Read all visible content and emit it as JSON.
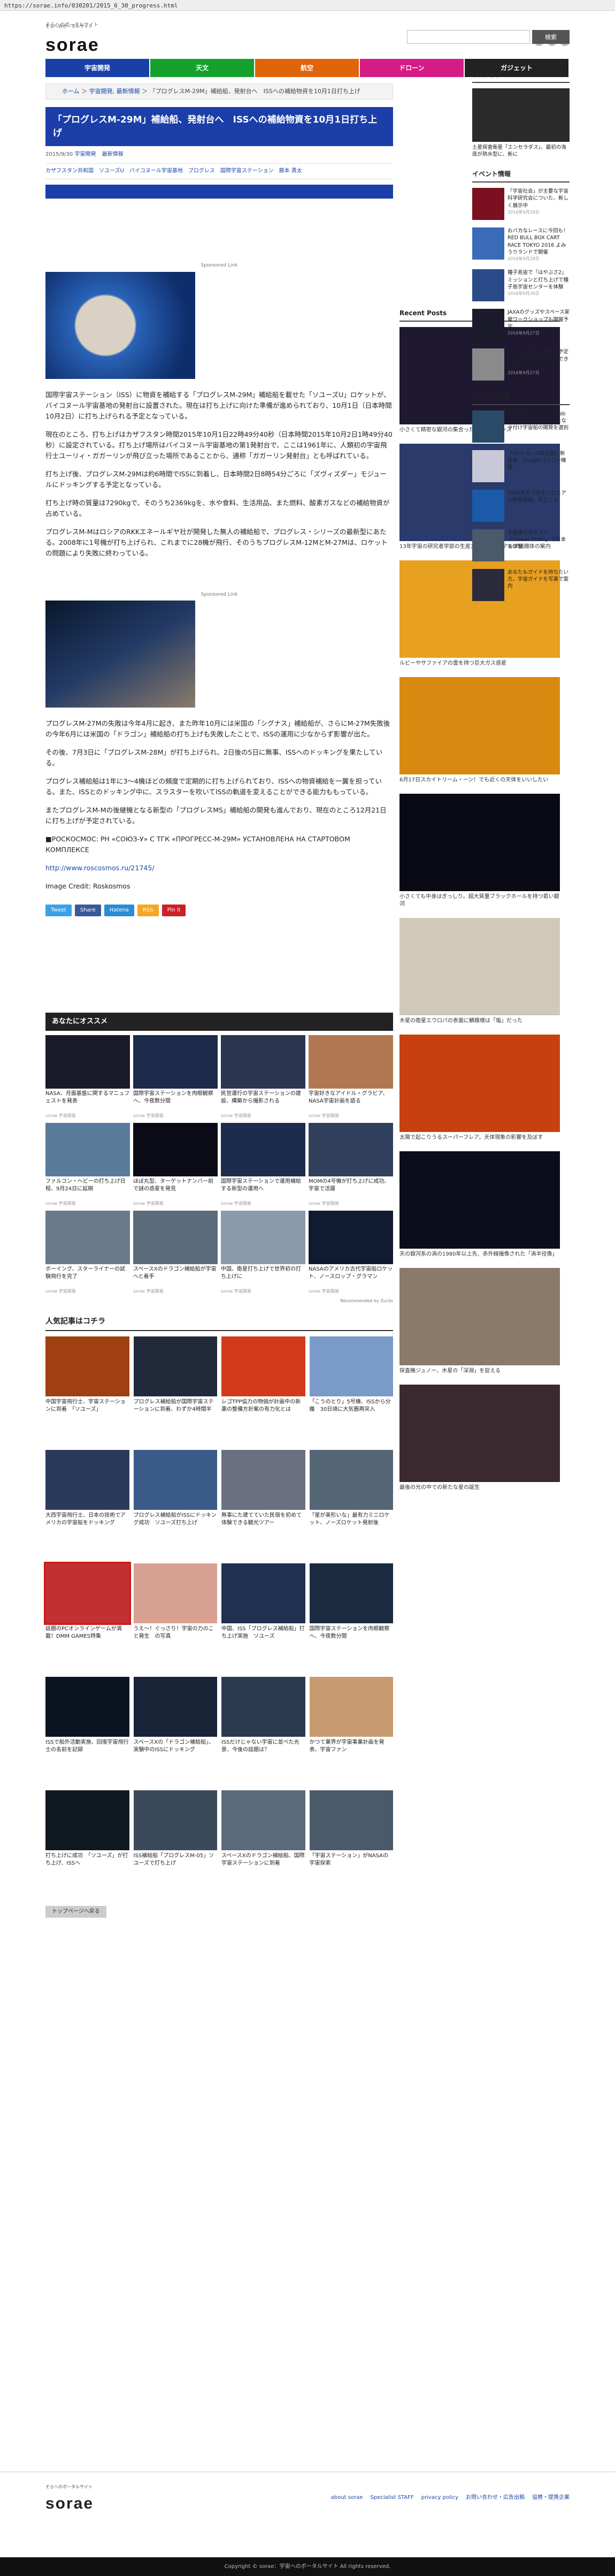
{
  "browser": {
    "url": "https://sorae.info/030201/2015_6_30_progress.html"
  },
  "site": {
    "tagline": "そらへのポータルサイト",
    "logo": "sorae"
  },
  "search": {
    "placeholder": "",
    "button": "検索"
  },
  "nav": [
    {
      "label": "宇宙開発",
      "color": "#1a3fa8"
    },
    {
      "label": "天文",
      "color": "#16a02d"
    },
    {
      "label": "航空",
      "color": "#e0650a"
    },
    {
      "label": "ドローン",
      "color": "#d51b86"
    },
    {
      "label": "ガジェット",
      "color": "#222222"
    }
  ],
  "breadcrumb": {
    "home": "ホーム",
    "category": "宇宙開発, 最新情報",
    "current": "「プログレスM-29M」補給船、発射台へ　ISSへの補給物資を10月1日打ち上げ"
  },
  "article": {
    "title": "「プログレスM-29M」補給船、発射台へ　ISSへの補給物資を10月1日打ち上げ",
    "date": "2015/9/30",
    "categories": [
      "宇宙開発",
      "最新情報"
    ],
    "tags": [
      "カザフスタン共和国",
      "ソユーズU",
      "バイコヌール宇宙基地",
      "プログレス",
      "国際宇宙ステーション",
      "藤本 勇太"
    ],
    "sponsor": "Sponsored Link",
    "paragraphs": [
      "国際宇宙ステーション（ISS）に物資を補給する「プログレスM-29M」補給船を載せた「ソユーズU」ロケットが、バイコヌール宇宙基地の発射台に設置された。現在は打ち上げに向けた準備が進められており、10月1日（日本時間10月2日）に打ち上げられる予定となっている。",
      "現在のところ、打ち上げはカザフスタン時間2015年10月1日22時49分40秒（日本時間2015年10月2日1時49分40秒）に設定されている。打ち上げ場所はバイコヌール宇宙基地の第1発射台で、ここは1961年に、人類初の宇宙飛行士ユーリィ・ガガーリンが飛び立った場所であることから、通称「ガガーリン発射台」とも呼ばれている。",
      "打ち上げ後、プログレスM-29Mは約6時間でISSに到着し、日本時間2日8時54分ごろに「ズヴィズダー」モジュールにドッキングする予定となっている。",
      "打ち上げ時の質量は7290kgで、そのうち2369kgを、水や食料、生活用品、また燃料、酸素ガスなどの補給物資が占めている。",
      "プログレスM-MはロシアのRKKエネールギヤ社が開発した無人の補給船で、プログレス・シリーズの最新型にあたる。2008年に1号機が打ち上げられ、これまでに28機が飛行、そのうちプログレスM-12MとM-27Mは、ロケットの問題により失敗に終わっている。",
      "プログレスM-27Mの失敗は今年4月に起き、また昨年10月には米国の「シグナス」補給船が、さらにM-27M失敗後の今年6月には米国の「ドラゴン」補給船の打ち上げも失敗したことで、ISSの運用に少なからず影響が出た。",
      "その後、7月3日に「プログレスM-28M」が打ち上げられ、2日後の5日に無事、ISSへのドッキングを果たしている。",
      "プログレス補給船は1年に3～4機ほどの頻度で定期的に打ち上げられており、ISSへの物資補給を一翼を担っている。また、ISSとのドッキング中に、スラスターを吹いてISSの軌道を変えることができる能力ももっている。",
      "またプログレスM-Mの後継機となる新型の「プログレスMS」補給船の開発も進んでおり、現在のところ12月21日に打ち上げが予定されている。"
    ],
    "source_text": "■РОСКОСМОС: РН «СОЮЗ-У» С ТГК «ПРОГРЕСС-М-29М» УСТАНОВЛЕНА НА СТАРТОВОМ КОМПЛЕКСЕ",
    "source_link": "http://www.roscosmos.ru/21745/",
    "credit": "Image Credit: Roskosmos"
  },
  "share": [
    {
      "label": "Tweet",
      "color": "#3aa1e8"
    },
    {
      "label": "Share",
      "color": "#3b5998"
    },
    {
      "label": "Hatena",
      "color": "#2a8cd6"
    },
    {
      "label": "RSS",
      "color": "#f5a623"
    },
    {
      "label": "Pin it",
      "color": "#cb2027"
    }
  ],
  "recommend": {
    "title": "あなたにオススメ",
    "source": "sorae 宇宙開発",
    "powered": "Recommended by Zucks",
    "items": [
      {
        "text": "NASA、月面基盤に関するマニュフェストを発表",
        "color": "#1a1a2a"
      },
      {
        "text": "国際宇宙ステーションを肉眼観察へ、今夜数分間",
        "color": "#1d2b4a"
      },
      {
        "text": "民営運行の宇宙ステーションの建設、構築から撮影される",
        "color": "#2b3550"
      },
      {
        "text": "宇宙好きなアイドル・グラビア、NASA宇宙計画を語る",
        "color": "#b07850"
      },
      {
        "text": "ファルコン・ヘビーの打ち上げ日程、9月24日に延期",
        "color": "#5a7a9a"
      },
      {
        "text": "ほぼ丸型、ターゲットナンバー前で謎の惑星を発見",
        "color": "#0b0b18"
      },
      {
        "text": "国際宇宙ステーションで運用補給する新型の運用へ",
        "color": "#1c2c4c"
      },
      {
        "text": "MOMの4号機が打ち上げに成功、宇宙で活躍",
        "color": "#30405c"
      },
      {
        "text": "ボーイング、スターライナーの試験飛行を完了",
        "color": "#6a7a8a"
      },
      {
        "text": "スペースXのドラゴン補給船が宇宙へと着手",
        "color": "#5b6b7b"
      },
      {
        "text": "中国、衛星打ち上げで世界初の打ち上げに",
        "color": "#8a9aaa"
      },
      {
        "text": "NASAのアメリカ古代宇宙船ロケット、ノースロップ・グラマン",
        "color": "#101a30"
      }
    ]
  },
  "popular": {
    "title": "人気記事はコチラ",
    "items": [
      {
        "text": "中国宇宙飛行士、宇宙ステーションに到着　「ソユーズ」",
        "color": "#a04010"
      },
      {
        "text": "プログレス補給船が国際宇宙ステーションに到着、わずか4時間半",
        "color": "#202a3a"
      },
      {
        "text": "レゴTPP協力の物価が計画中の新薬の整備方針案の有力化とは",
        "color": "#d23a1a"
      },
      {
        "text": "「こうのとり」5号機、ISSから分離　30日頃に大気圏再突入",
        "color": "#7a9ac8"
      },
      {
        "text": "大西宇宙飛行士、日本の技術でアメリカの宇宙船をドッキング",
        "color": "#2a3a5a"
      },
      {
        "text": "プログレス補給船がISSにドッキング成功　ソユーズ打ち上げ",
        "color": "#3a5a8a"
      },
      {
        "text": "無事にた建てていた民宿を初めて体験できる観光ツアー",
        "color": "#6a7080"
      },
      {
        "text": "「星が美形いな」最有力ミニロケット、ノーズロケット発射後",
        "color": "#556677"
      },
      {
        "text": "話題のPCオンラインゲームが満載！DMM GAMES特集",
        "color": "#c23030"
      },
      {
        "text": "うえ～！ぐっさり！宇宙の力のこと発生　の写真",
        "color": "#d8a090"
      },
      {
        "text": "中国、ISS「プログレス補給船」打ち上げ実施　ソユーズ",
        "color": "#203050"
      },
      {
        "text": "国際宇宙ステーションを肉眼観察へ、今夜数分間",
        "color": "#1a2a40"
      },
      {
        "text": "ISSで船外活動実施、回復宇宙飛行士の名前を記録",
        "color": "#0a1420"
      },
      {
        "text": "スペースXの「ドラゴン補給船」、実験中のISSにドッキング",
        "color": "#1a2438"
      },
      {
        "text": "ISSだけじゃない宇宙に並べた光景、今後の話題は？",
        "color": "#2a3a50"
      },
      {
        "text": "かつて業界が宇宙事業計画を発表、宇宙ファン",
        "color": "#c89a70"
      },
      {
        "text": "打ち上げに成功　「ソユーズ」が打ち上げ、ISSへ",
        "color": "#101820"
      },
      {
        "text": "ISS補給船「プログレスM-05」ソユーズで打ち上げ",
        "color": "#3a4a5a"
      },
      {
        "text": "スペースXのドラゴン補給船、国際宇宙ステーションに到着",
        "color": "#5a6a7a"
      },
      {
        "text": "「宇宙ステーション」がNASAの宇宙探索",
        "color": "#4a5a6a"
      }
    ]
  },
  "top_button": "トップページへ戻る",
  "recent": {
    "title": "Recent Posts",
    "items": [
      {
        "text": "小さくて精密な銀河の集合った文書のサウンズ",
        "color": "#1e1830"
      },
      {
        "text": "13年宇宙の研究者学部の生産方式のお金をアルプ組織体の案内",
        "color": "#2a3a6a"
      },
      {
        "text": "ルビーやサファイアの雲を持つ巨大ガス惑星",
        "color": "#e8a020"
      },
      {
        "text": "6月17日スカイトリーム・ーン！でも近くの天体をいいしたい",
        "color": "#d88a10"
      },
      {
        "text": "小さくても中身はぎっしり。超大質量ブラックホールを持つ若い銀河",
        "color": "#0a0a14"
      },
      {
        "text": "木星の衛星エウロパの表面に鱗模様は「塩」だった",
        "color": "#d0c8b8"
      },
      {
        "text": "太陽で起こりうるスーパーフレア。天体現象の影響を及ぼす",
        "color": "#c84010"
      },
      {
        "text": "天の銀河系の渦の1980年以上先、赤外線撮像された「渦半径像」",
        "color": "#0c0c1a"
      },
      {
        "text": "探査機ジュノー、木星の「深淵」を捉える",
        "color": "#8a7a6a"
      },
      {
        "text": "最後の光の中での新たな星の誕生",
        "color": "#3a2a30"
      }
    ]
  },
  "right": {
    "pickup_title": "宇宙大賞ピックアップ",
    "pickup_text": "土星探査衛星「エンセラダス」、最初の海底が熱水型に、新に",
    "event_title": "イベント情報",
    "events": [
      {
        "text": "「宇宙社会」が主要な宇宙科学研究会についた、新しく展示中",
        "date": "2016年9月28日",
        "color": "#7a1020"
      },
      {
        "text": "おバカなレースに今回も！ RED BULL BOX CART RACE TOKYO 2016 よみうりランドで開催",
        "date": "2016年9月28日",
        "color": "#3a6ab8"
      },
      {
        "text": "種子島宙で「はやぶさ2」ミッションと打ち上げで種子島宇宙センターを体験",
        "date": "2016年9月28日",
        "color": "#2a4a8a"
      },
      {
        "text": "JAXAのグッズやスペース家屋ワークショップも開催予定",
        "date": "2016年9月27日",
        "color": "#1a1a2a"
      },
      {
        "text": "トヨタ「宇宙で実験」予定のカプセル乗りを見学できる展示",
        "date": "2016年9月27日",
        "color": "#8a8a8a"
      }
    ],
    "column_title": "コラム・特集",
    "columns": [
      {
        "text": "宇宙船をしない。Kaibab Space Programが新たなラ付け宇宙船の開発を選別",
        "color": "#2a4a6a"
      },
      {
        "text": "「VAIO S」の拡大版に新搭載。Googleパソコン機種",
        "color": "#c8c8d8"
      },
      {
        "text": "2016年までのエンジニアの開発技術、見どころ",
        "color": "#1a5aa8"
      },
      {
        "text": "宇宙論でのカメラ「Flower Photo」で日本を体験",
        "color": "#4a5a6a"
      },
      {
        "text": "あなたもガイドを持ちたい方。宇宙ガイドを写真で案内",
        "color": "#2a2a3a"
      }
    ]
  },
  "footer": {
    "links": [
      "about sorae",
      "Specialist STAFF",
      "privacy policy",
      "お問い合わせ・広告出稿",
      "協賛・提携企業"
    ],
    "copyright": "Copyright © sorae：宇宙へのポータルサイト All rights reserved."
  }
}
